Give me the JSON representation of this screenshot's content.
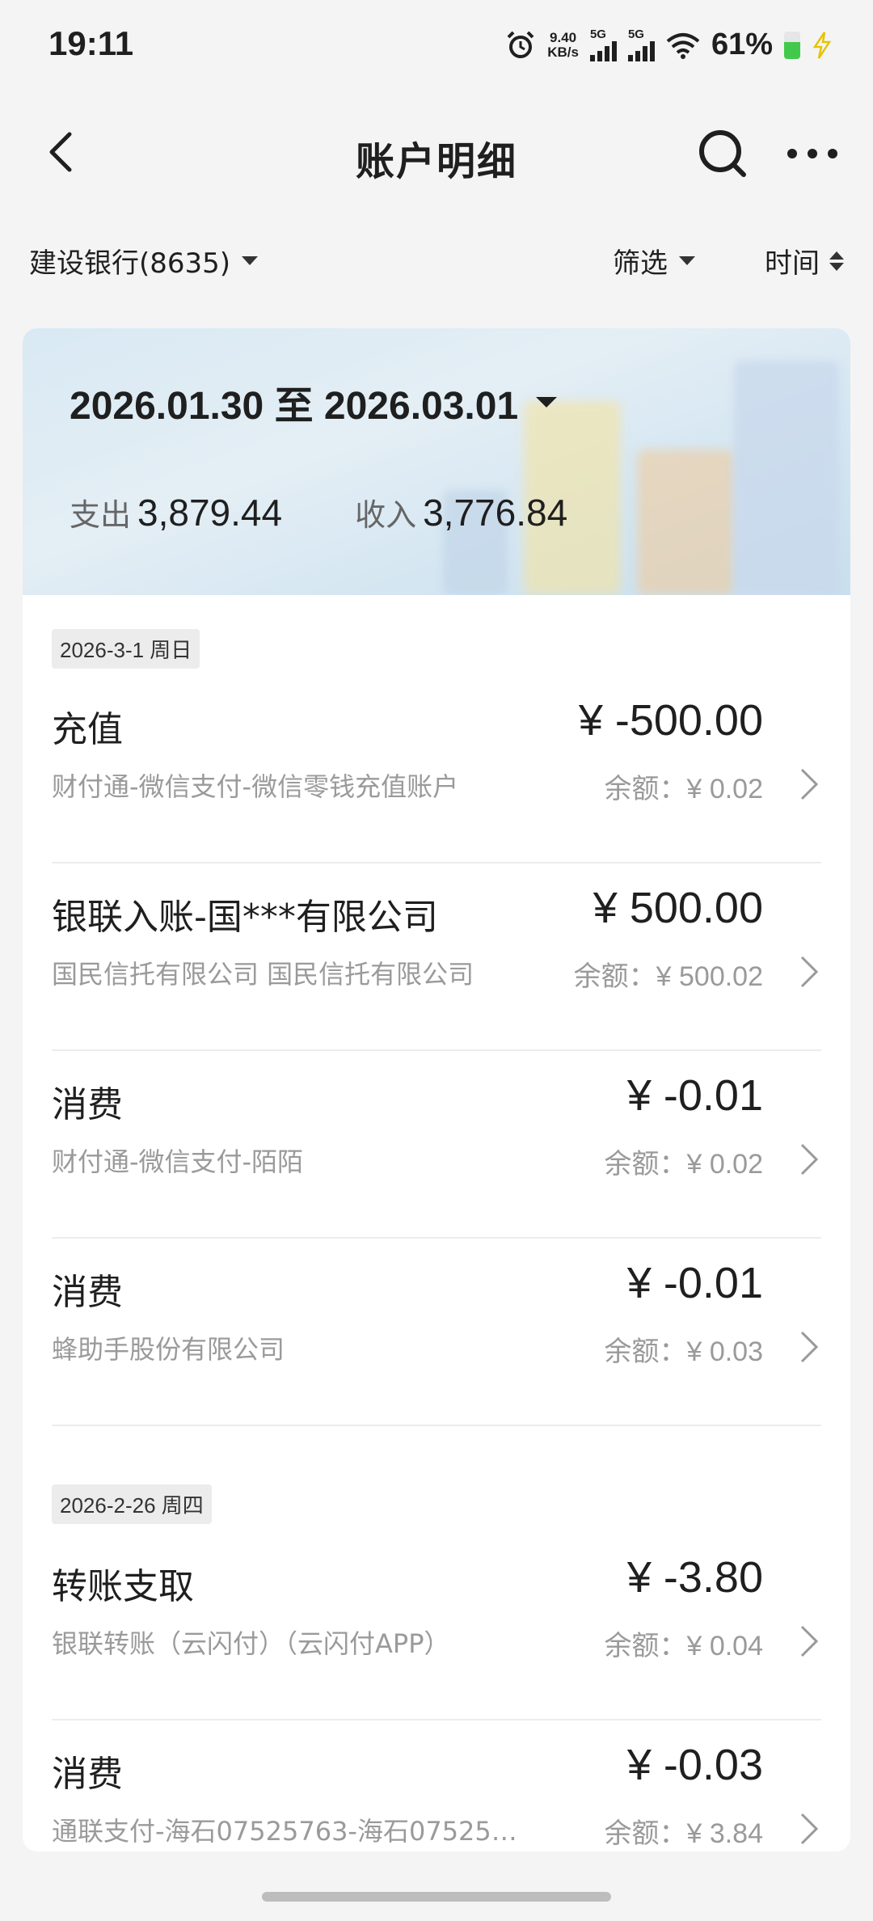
{
  "status_bar": {
    "time": "19:11",
    "net_speed_value": "9.40",
    "net_speed_unit": "KB/s",
    "sim1": "5G",
    "sim2": "5G",
    "battery_percent": "61%",
    "battery_level": 0.61,
    "icons": [
      "alarm-icon",
      "signal-icon",
      "signal-icon",
      "wifi-icon",
      "battery-icon",
      "charging-icon"
    ]
  },
  "header": {
    "title": "账户明细",
    "back_icon": "back-arrow-icon",
    "search_icon": "search-icon",
    "more_icon": "more-icon"
  },
  "filters": {
    "account": "建设银行(8635)",
    "filter": "筛选",
    "sort": "时间"
  },
  "summary": {
    "date_range": "2026.01.30 至 2026.03.01",
    "expense_label": "支出",
    "expense_value": "3,879.44",
    "income_label": "收入",
    "income_value": "3,776.84"
  },
  "groups": [
    {
      "date": "2026-3-1 周日",
      "items": [
        {
          "name": "充值",
          "desc": "财付通-微信支付-微信零钱充值账户",
          "amount": "¥ -500.00",
          "balance_label": "余额：",
          "balance": "¥ 0.02"
        },
        {
          "name": "银联入账-国***有限公司",
          "desc": "国民信托有限公司 国民信托有限公司",
          "amount": "¥ 500.00",
          "balance_label": "余额：",
          "balance": "¥ 500.02"
        },
        {
          "name": "消费",
          "desc": "财付通-微信支付-陌陌",
          "amount": "¥ -0.01",
          "balance_label": "余额：",
          "balance": "¥ 0.02"
        },
        {
          "name": "消费",
          "desc": "蜂助手股份有限公司",
          "amount": "¥ -0.01",
          "balance_label": "余额：",
          "balance": "¥ 0.03"
        }
      ]
    },
    {
      "date": "2026-2-26 周四",
      "items": [
        {
          "name": "转账支取",
          "desc": "银联转账（云闪付）（云闪付APP）",
          "amount": "¥ -3.80",
          "balance_label": "余额：",
          "balance": "¥ 0.04"
        },
        {
          "name": "消费",
          "desc": "通联支付-海石07525763-海石07525…",
          "amount": "¥ -0.03",
          "balance_label": "余额：",
          "balance": "¥ 3.84"
        }
      ]
    }
  ]
}
